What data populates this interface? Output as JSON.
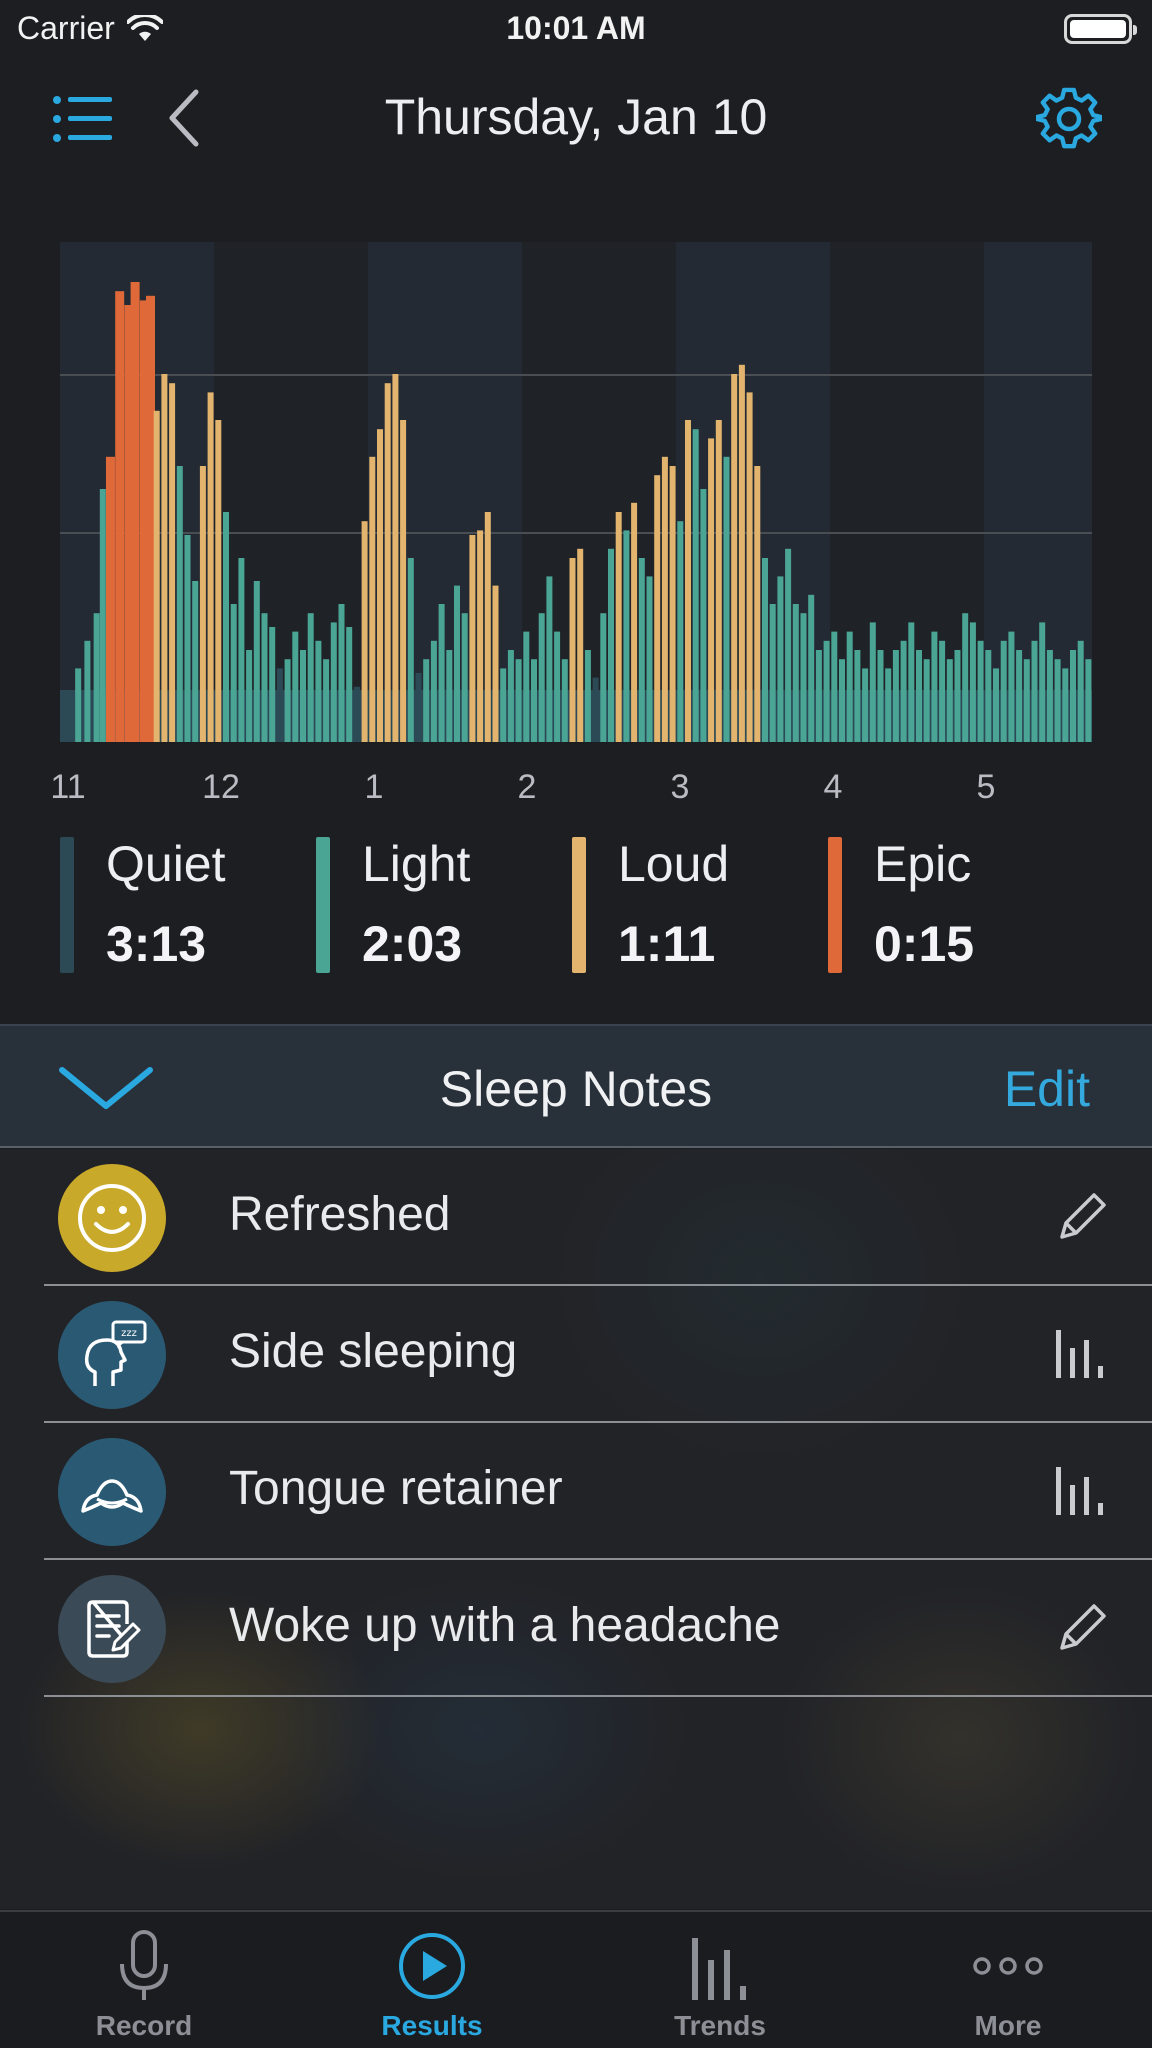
{
  "status_bar": {
    "carrier": "Carrier",
    "time": "10:01 AM"
  },
  "header": {
    "title": "Thursday, Jan 10"
  },
  "chart_data": {
    "type": "bar",
    "x_ticks": [
      "11",
      "12",
      "1",
      "2",
      "3",
      "4",
      "5"
    ],
    "gridlines": 2,
    "colors": {
      "quiet": "#2b4a56",
      "light": "#4aa595",
      "loud": "#e2b46e",
      "epic": "#e0693a"
    },
    "x_hours": [
      0.04,
      0.1,
      0.16,
      0.2,
      0.24,
      0.3,
      0.36,
      0.4,
      0.46,
      0.5,
      0.55,
      0.6,
      0.65,
      0.7,
      0.75,
      0.8,
      0.85,
      0.9,
      0.95,
      1.0,
      1.05,
      1.1,
      1.15,
      1.2,
      1.25,
      1.3,
      1.35,
      1.4,
      1.45,
      1.5,
      1.55,
      1.6,
      1.65,
      1.7,
      1.75,
      1.8,
      1.85,
      1.9,
      1.95,
      2.0,
      2.05,
      2.1,
      2.15,
      2.2,
      2.25,
      2.3,
      2.35,
      2.4,
      2.45,
      2.5,
      2.55,
      2.6,
      2.65,
      2.7,
      2.75,
      2.8,
      2.85,
      2.9,
      2.95,
      3.0,
      3.05,
      3.1,
      3.15,
      3.2,
      3.25,
      3.3,
      3.35,
      3.4,
      3.45,
      3.5,
      3.55,
      3.6,
      3.65,
      3.7,
      3.75,
      3.8,
      3.85,
      3.9,
      3.95,
      4.0,
      4.05,
      4.1,
      4.15,
      4.2,
      4.25,
      4.3,
      4.35,
      4.4,
      4.45,
      4.5,
      4.55,
      4.6,
      4.65,
      4.7,
      4.75,
      4.8,
      4.85,
      4.9,
      4.95,
      5.0,
      5.05,
      5.1,
      5.15,
      5.2,
      5.25,
      5.3,
      5.35,
      5.4,
      5.45,
      5.5,
      5.55,
      5.6,
      5.65,
      5.7,
      5.75,
      5.8,
      5.85,
      5.9,
      5.95,
      6.0,
      6.05,
      6.1,
      6.15,
      6.2,
      6.25,
      6.3,
      6.35,
      6.4,
      6.45,
      6.5,
      6.55,
      6.6,
      6.65,
      6.7,
      6.72
    ],
    "values": [
      16,
      22,
      28,
      55,
      62,
      98,
      95,
      100,
      96,
      97,
      72,
      80,
      78,
      60,
      45,
      35,
      60,
      76,
      70,
      50,
      30,
      40,
      20,
      35,
      28,
      25,
      16,
      18,
      24,
      20,
      28,
      22,
      18,
      26,
      30,
      25,
      12,
      48,
      62,
      68,
      78,
      80,
      70,
      40,
      15,
      18,
      22,
      30,
      20,
      34,
      28,
      45,
      46,
      50,
      34,
      16,
      20,
      18,
      24,
      18,
      28,
      36,
      24,
      18,
      40,
      42,
      20,
      14,
      28,
      42,
      50,
      46,
      52,
      40,
      36,
      58,
      62,
      60,
      48,
      70,
      68,
      55,
      66,
      70,
      62,
      80,
      82,
      76,
      60,
      40,
      30,
      36,
      42,
      30,
      28,
      32,
      20,
      22,
      24,
      18,
      24,
      20,
      16,
      26,
      20,
      16,
      20,
      22,
      26,
      20,
      18,
      24,
      22,
      18,
      20,
      28,
      26,
      22,
      20,
      16,
      22,
      24,
      20,
      18,
      22,
      26,
      20,
      18,
      16,
      20,
      22,
      18,
      16,
      14,
      12,
      12,
      12
    ],
    "stages": [
      "light",
      "light",
      "light",
      "light",
      "epic",
      "epic",
      "epic",
      "epic",
      "epic",
      "epic",
      "loud",
      "loud",
      "loud",
      "light",
      "light",
      "light",
      "loud",
      "loud",
      "loud",
      "light",
      "light",
      "light",
      "light",
      "light",
      "light",
      "light",
      "quiet",
      "light",
      "light",
      "light",
      "light",
      "light",
      "light",
      "light",
      "light",
      "light",
      "quiet",
      "loud",
      "loud",
      "loud",
      "loud",
      "loud",
      "loud",
      "light",
      "quiet",
      "light",
      "light",
      "light",
      "light",
      "light",
      "light",
      "loud",
      "loud",
      "loud",
      "loud",
      "light",
      "light",
      "light",
      "light",
      "light",
      "light",
      "light",
      "light",
      "light",
      "loud",
      "loud",
      "light",
      "quiet",
      "light",
      "light",
      "loud",
      "light",
      "loud",
      "light",
      "light",
      "loud",
      "loud",
      "loud",
      "light",
      "loud",
      "light",
      "light",
      "loud",
      "loud",
      "light",
      "loud",
      "loud",
      "loud",
      "loud",
      "light",
      "light",
      "light",
      "light",
      "light",
      "light",
      "light",
      "light",
      "light",
      "light",
      "light",
      "light",
      "light",
      "light",
      "light",
      "light",
      "light",
      "light",
      "light",
      "light",
      "light",
      "light",
      "light",
      "light",
      "light",
      "light",
      "light",
      "light",
      "light",
      "light",
      "light",
      "light",
      "light",
      "light",
      "light",
      "light",
      "light",
      "light",
      "light",
      "light",
      "light",
      "light",
      "light",
      "light",
      "light",
      "light",
      "light",
      "light"
    ]
  },
  "legend": [
    {
      "label": "Quiet",
      "value": "3:13",
      "color": "#2b4a56"
    },
    {
      "label": "Light",
      "value": "2:03",
      "color": "#4aa595"
    },
    {
      "label": "Loud",
      "value": "1:11",
      "color": "#e2b46e"
    },
    {
      "label": "Epic",
      "value": "0:15",
      "color": "#e0693a"
    }
  ],
  "sleep_notes": {
    "title": "Sleep Notes",
    "edit_label": "Edit",
    "items": [
      {
        "label": "Refreshed",
        "icon": "smiley-face-icon",
        "action": "pencil-icon",
        "icon_bg": "#c8a92a"
      },
      {
        "label": "Side sleeping",
        "icon": "side-sleeping-head-icon",
        "action": "bar-chart-icon",
        "icon_bg": "#2a5a73"
      },
      {
        "label": "Tongue retainer",
        "icon": "tongue-retainer-icon",
        "action": "bar-chart-icon",
        "icon_bg": "#2a5a73"
      },
      {
        "label": "Woke up with a headache",
        "icon": "notepad-icon",
        "action": "pencil-icon",
        "icon_bg": "#3a4a56"
      }
    ]
  },
  "tab_bar": {
    "tabs": [
      {
        "label": "Record",
        "icon": "microphone-icon"
      },
      {
        "label": "Results",
        "icon": "play-circle-icon",
        "active": true
      },
      {
        "label": "Trends",
        "icon": "bar-chart-icon"
      },
      {
        "label": "More",
        "icon": "three-dots-icon"
      }
    ]
  },
  "accent_color": "#2aa8e0"
}
